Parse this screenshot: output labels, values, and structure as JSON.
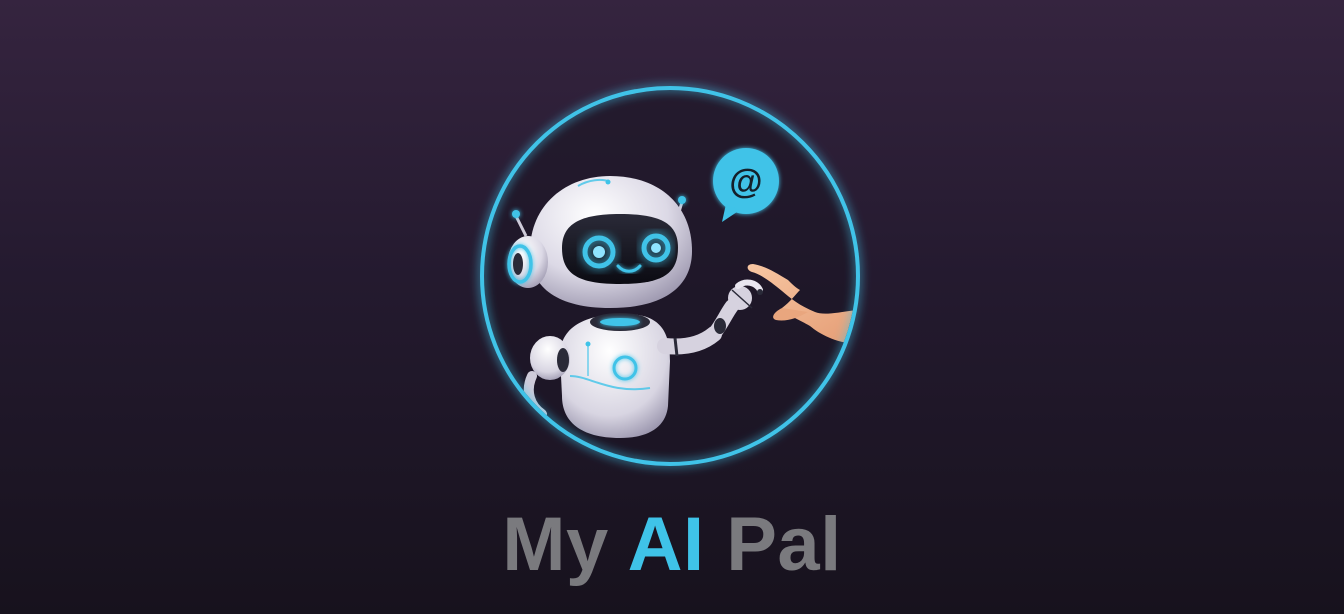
{
  "brand": {
    "title_part1": "My",
    "title_part2": "AI",
    "title_part3": "Pal",
    "speech_bubble_symbol": "@"
  },
  "colors": {
    "background_top": "#35243f",
    "background_bottom": "#17121d",
    "accent_cyan": "#3fc3e8",
    "title_gray": "#7a7a7e",
    "robot_body": "#e6e4ee",
    "skin": "#f2b58e"
  },
  "icons": {
    "logo": "robot-touching-human-hand-icon",
    "bubble": "at-sign-speech-bubble-icon"
  }
}
